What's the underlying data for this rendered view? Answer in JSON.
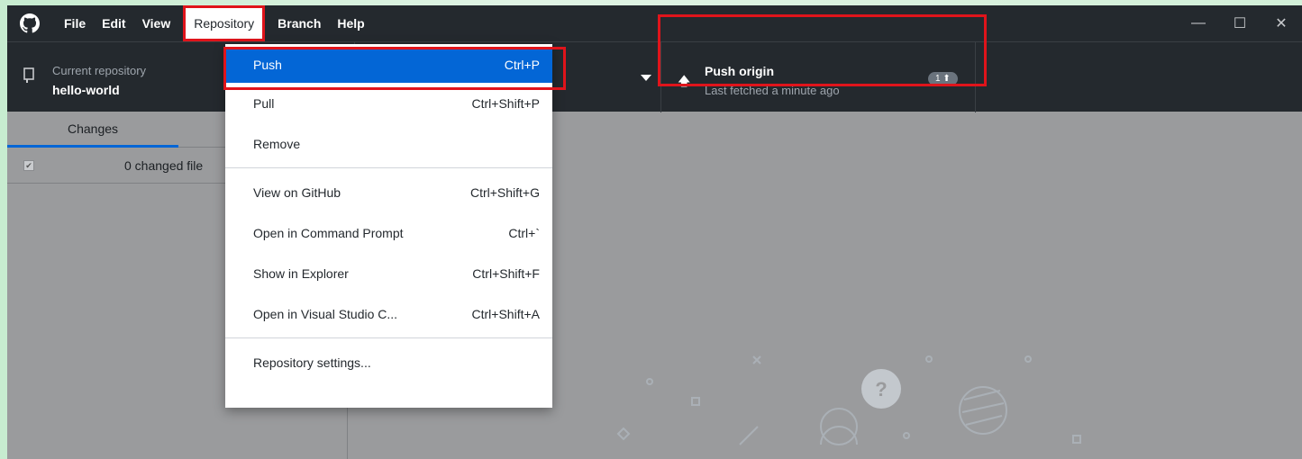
{
  "menubar": {
    "items": [
      "File",
      "Edit",
      "View",
      "Repository",
      "Branch",
      "Help"
    ],
    "open_item": "Repository"
  },
  "window_controls": {
    "minimize": "—",
    "maximize": "☐",
    "close": "✕"
  },
  "repository": {
    "caption": "Current repository",
    "name": "hello-world"
  },
  "push": {
    "title": "Push origin",
    "subtitle": "Last fetched a minute ago",
    "badge": "1 ⬆"
  },
  "sidebar": {
    "tab_changes": "Changes",
    "changed_files": "0 changed file"
  },
  "dropdown": {
    "items": [
      {
        "label": "Push",
        "shortcut": "Ctrl+P"
      },
      {
        "label": "Pull",
        "shortcut": "Ctrl+Shift+P"
      },
      {
        "label": "Remove",
        "shortcut": ""
      },
      {
        "label": "View on GitHub",
        "shortcut": "Ctrl+Shift+G"
      },
      {
        "label": "Open in Command Prompt",
        "shortcut": "Ctrl+`"
      },
      {
        "label": "Show in Explorer",
        "shortcut": "Ctrl+Shift+F"
      },
      {
        "label": "Open in Visual Studio C...",
        "shortcut": "Ctrl+Shift+A"
      },
      {
        "label": "Repository settings...",
        "shortcut": ""
      }
    ]
  },
  "colors": {
    "titlebar": "#24292e",
    "selected": "#0366d6",
    "highlight": "#e0141b",
    "content_bg": "#9a9b9d"
  }
}
